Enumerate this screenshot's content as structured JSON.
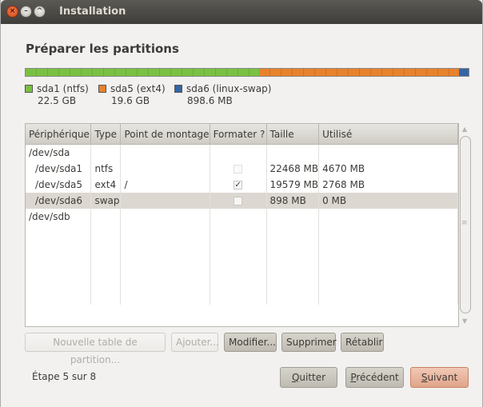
{
  "window": {
    "title": "Installation"
  },
  "heading": "Préparer les partitions",
  "partition_bar": [
    {
      "name": "sda1 (ntfs)",
      "size": "22.5 GB",
      "color": "#7ac143",
      "fraction": 0.5263
    },
    {
      "name": "sda5 (ext4)",
      "size": "19.6 GB",
      "color": "#e8822d",
      "fraction": 0.4527
    },
    {
      "name": "sda6 (linux-swap)",
      "size": "898.6 MB",
      "color": "#3465a4",
      "fraction": 0.021
    }
  ],
  "table": {
    "headers": [
      "Périphérique",
      "Type",
      "Point de montage",
      "Formater ?",
      "Taille",
      "Utilisé"
    ],
    "rows": [
      {
        "device": "/dev/sda",
        "type": "",
        "mount": "",
        "format": "",
        "size": "",
        "used": ""
      },
      {
        "device": "/dev/sda1",
        "type": "ntfs",
        "mount": "",
        "format": "disabled",
        "size": "22468 MB",
        "used": "4670 MB"
      },
      {
        "device": "/dev/sda5",
        "type": "ext4",
        "mount": "/",
        "format": "checked",
        "size": "19579 MB",
        "used": "2768 MB"
      },
      {
        "device": "/dev/sda6",
        "type": "swap",
        "mount": "",
        "format": "unchecked",
        "size": "898 MB",
        "used": "0 MB",
        "selected": true
      },
      {
        "device": "/dev/sdb",
        "type": "",
        "mount": "",
        "format": "",
        "size": "",
        "used": ""
      }
    ]
  },
  "actions": {
    "new_table": "Nouvelle table de partition...",
    "add": "Ajouter...",
    "modify": "Modifier...",
    "delete": "Supprimer",
    "revert": "Rétablir"
  },
  "footer": {
    "step": "Étape 5 sur 8",
    "quit": {
      "mnemonic": "Q",
      "rest": "uitter"
    },
    "back": {
      "mnemonic": "P",
      "rest": "récédent"
    },
    "next": {
      "mnemonic": "S",
      "rest": "uivant"
    }
  }
}
